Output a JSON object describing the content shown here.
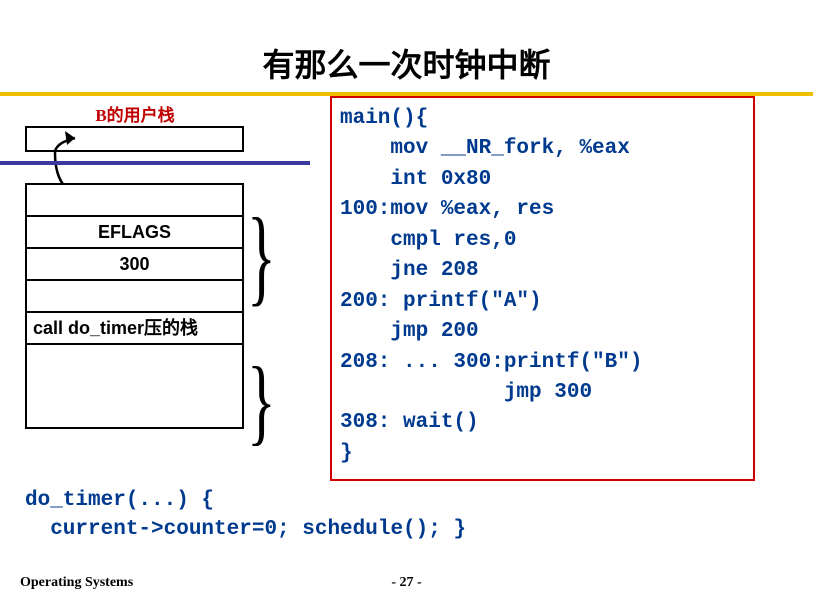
{
  "title": "有那么一次时钟中断",
  "left": {
    "user_stack_label": "B的用户栈",
    "kernel_rows": {
      "blank_top": "",
      "eflags": "EFLAGS",
      "ret_addr": "300",
      "blank_mid": "",
      "call_frame": "call do_timer压的栈"
    }
  },
  "code_lines": {
    "l1": "main(){",
    "l2": "    mov __NR_fork, %eax",
    "l3": "    int 0x80",
    "l4": "100:mov %eax, res",
    "l5": "    cmpl res,0",
    "l6": "    jne 208",
    "l7": "200: printf(\"A\")",
    "l8": "    jmp 200",
    "l9": "208: ... 300:printf(\"B\")",
    "l10": "             jmp 300",
    "l11": "308: wait()",
    "l12": "}"
  },
  "bottom_code": {
    "l1": "do_timer(...) {",
    "l2": "  current->counter=0; schedule(); }"
  },
  "footer": {
    "left": "Operating Systems",
    "page": "- 27 -"
  }
}
